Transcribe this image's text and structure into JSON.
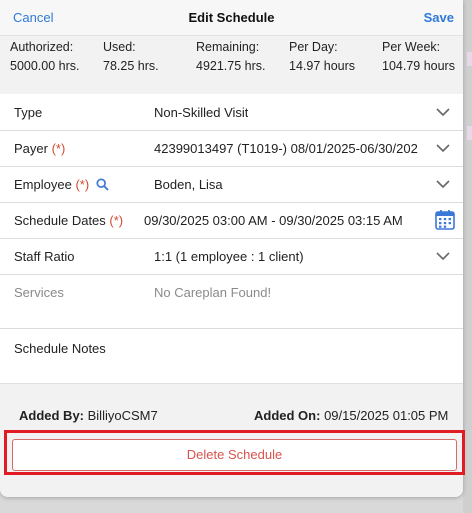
{
  "header": {
    "cancel_label": "Cancel",
    "title": "Edit Schedule",
    "save_label": "Save"
  },
  "stats": [
    {
      "label": "Authorized:",
      "value": "5000.00 hrs."
    },
    {
      "label": "Used:",
      "value": "78.25 hrs."
    },
    {
      "label": "Remaining:",
      "value": "4921.75 hrs."
    },
    {
      "label": "Per Day:",
      "value": "14.97 hours"
    },
    {
      "label": "Per Week:",
      "value": "104.79 hours"
    }
  ],
  "form": {
    "type": {
      "label": "Type",
      "value": "Non-Skilled Visit"
    },
    "payer": {
      "label": "Payer",
      "required": "(*)",
      "value": "42399013497 (T1019-) 08/01/2025-06/30/202"
    },
    "employee": {
      "label": "Employee",
      "required": "(*)",
      "value": "Boden, Lisa"
    },
    "schedule_dates": {
      "label": "Schedule Dates",
      "required": "(*)",
      "value": "09/30/2025 03:00 AM - 09/30/2025 03:15 AM"
    },
    "staff_ratio": {
      "label": "Staff Ratio",
      "value": "1:1 (1 employee : 1 client)"
    },
    "services": {
      "label": "Services",
      "value": "No Careplan Found!"
    },
    "notes": {
      "label": "Schedule Notes"
    }
  },
  "footer": {
    "added_by_label": "Added By:",
    "added_by_value": "BilliyoCSM7",
    "added_on_label": "Added On:",
    "added_on_value": "09/15/2025 01:05 PM",
    "delete_label": "Delete Schedule"
  },
  "icons": {
    "chevron": "chevron-down-icon",
    "search": "search-icon",
    "calendar": "calendar-icon"
  },
  "colors": {
    "link_blue": "#2f7ad9",
    "required_red": "#d24a2f",
    "delete_red": "#d9534f",
    "highlight_red": "#e01b24"
  }
}
